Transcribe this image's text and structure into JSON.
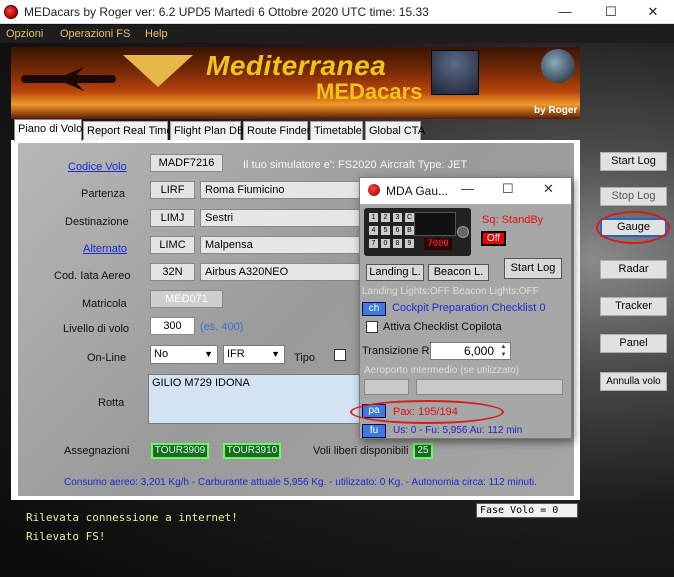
{
  "window": {
    "title": "MEDacars by Roger ver: 6.2 UPD5    Martedì 6 Ottobre 2020    UTC time: 15.33",
    "controls": {
      "minimize": "—",
      "maximize": "☐",
      "close": "✕"
    }
  },
  "menu": [
    "Opzioni",
    "Operazioni FS",
    "Help"
  ],
  "banner": {
    "title": "Mediterranea",
    "subtitle": "MEDacars",
    "byline": "by Roger"
  },
  "tabs": [
    "Piano di Volo",
    "Report Real Time",
    "Flight Plan DB",
    "Route Finder",
    "Timetable",
    "Global CTA"
  ],
  "form": {
    "codice_volo_label": "Codice Volo",
    "codice_volo": "MADF7216",
    "simulator_text": "Il tuo simulatore e': FS2020",
    "aircraft_type": "Aircraft Type: JET",
    "partenza_label": "Partenza",
    "partenza_icao": "LIRF",
    "partenza_name": "Roma Fiumicino",
    "destinazione_label": "Destinazione",
    "destinazione_icao": "LIMJ",
    "destinazione_name": "Sestri",
    "alternato_label": "Alternato",
    "alternato_icao": "LIMC",
    "alternato_name": "Malpensa",
    "cod_iata_label": "Cod. Iata Aereo",
    "cod_iata": "32N",
    "aereo_name": "Airbus A320NEO",
    "matricola_label": "Matricola",
    "matricola": "MED071",
    "livello_label": "Livello di volo",
    "livello": "300",
    "livello_hint": "(es. 400)",
    "online_label": "On-Line",
    "online_value": "No",
    "rules_value": "IFR",
    "tipo_label": "Tipo",
    "rotta_label": "Rotta",
    "rotta": "GILIO M729 IDONA",
    "assegnazioni_label": "Assegnazioni",
    "assegnazione_1": "TOUR3909",
    "assegnazione_2": "TOUR3910",
    "voli_liberi_label": "Voli liberi disponibili",
    "voli_liberi": "25",
    "consumo": "Consumo aereo: 3,201 Kg/h - Carburante attuale 5,956 Kg. - utilizzato: 0 Kg. - Autonomia circa: 112 minuti."
  },
  "right_buttons": [
    "Start Log",
    "Stop Log",
    "Gauge",
    "Radar",
    "Tracker",
    "Panel",
    "Annulla volo"
  ],
  "gauge": {
    "title": "MDA Gau...",
    "controls": {
      "minimize": "—",
      "maximize": "☐",
      "close": "✕"
    },
    "squawk_code": "7000",
    "squawk_status": "Sq: StandBy",
    "off_label": "Off",
    "landing_btn": "Landing L.",
    "beacon_btn": "Beacon L.",
    "start_log_btn": "Start Log",
    "lights_status": "Landing Lights:OFF Beacon Lights:OFF",
    "ch_btn": "ch",
    "checklist_text": "Cockpit Preparation Checklist 0",
    "copilot_label": "Attiva Checklist Copilota",
    "transizione_label": "Transizione R.",
    "transizione_value": "6,000",
    "aeroporto_label": "Aeroporto intermedio (se utilizzato)",
    "pa_btn": "pa",
    "pax_text": "Pax: 195/194",
    "fu_btn": "fu",
    "fuel_text": "Us: 0 - Fu: 5,956 Au: 112 min",
    "keypad": [
      "1",
      "2",
      "3",
      "4",
      "5",
      "6",
      "7",
      "0",
      "8",
      "9",
      "C",
      "B"
    ]
  },
  "console": {
    "line1": "Rilevata connessione a internet!",
    "line2": "Rilevato FS!",
    "fase": "Fase Volo = 0"
  },
  "colors": {
    "accent_red": "#d61c1c",
    "link_blue": "#1a2ccc",
    "banner_gold": "#f2c417"
  }
}
